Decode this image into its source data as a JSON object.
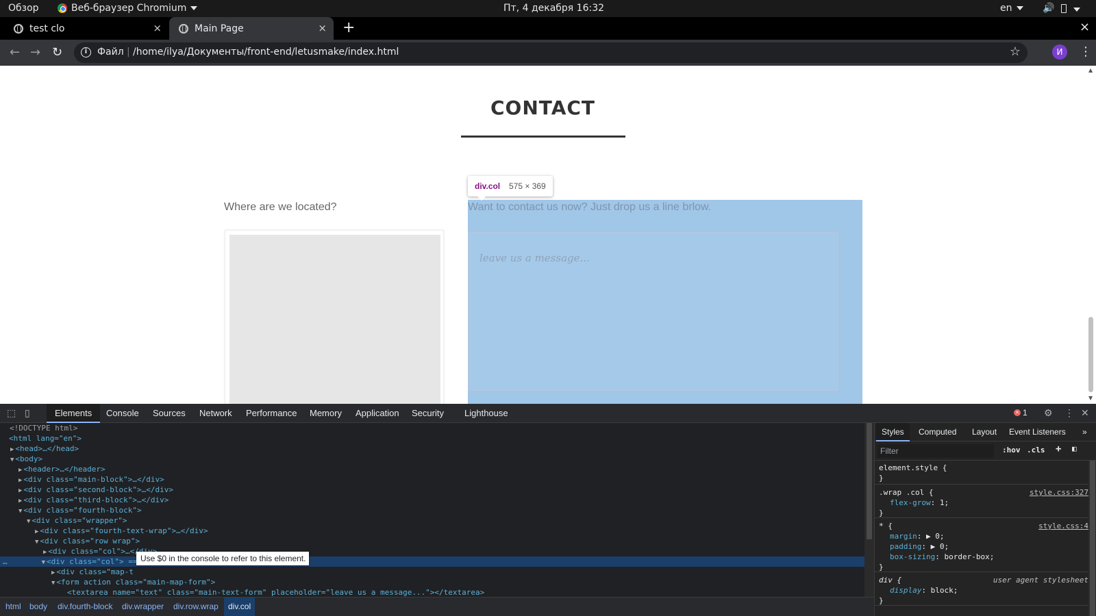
{
  "gnome": {
    "overview": "Обзор",
    "app_name": "Веб-браузер Chromium",
    "clock": "Пт, 4 декабря  16:32",
    "lang": "en"
  },
  "browser": {
    "tabs": [
      {
        "title": "test clo"
      },
      {
        "title": "Main Page"
      }
    ],
    "newtab_label": "+",
    "close_glyph": "×",
    "scheme_label": "Файл",
    "url": "/home/ilya/Документы/front-end/letusmake/index.html",
    "avatar_initial": "И"
  },
  "page": {
    "contact_title": "CONTACT",
    "located_text": "Where are we located?",
    "contact_now_text": "Want to contact us now? Just drop us a line brlow.",
    "textarea_placeholder": "leave us a message...",
    "inspect_tooltip": {
      "tag": "div.col",
      "dims": "575 × 369"
    }
  },
  "devtools": {
    "tabs": [
      "Elements",
      "Console",
      "Sources",
      "Network",
      "Performance",
      "Memory",
      "Application",
      "Security",
      "Lighthouse"
    ],
    "error_count": "1",
    "dom_lines": [
      {
        "t": "<!DOCTYPE html>"
      },
      {
        "t": "<html lang=\"en\">"
      },
      {
        "t": "<head>…</head>"
      },
      {
        "t": "<body>"
      },
      {
        "t": "<header>…</header>"
      },
      {
        "t": "<div class=\"main-block\">…</div>"
      },
      {
        "t": "<div class=\"second-block\">…</div>"
      },
      {
        "t": "<div class=\"third-block\">…</div>"
      },
      {
        "t": "<div class=\"fourth-block\">"
      },
      {
        "t": "<div class=\"wrapper\">"
      },
      {
        "t": "<div class=\"fourth-text-wrap\">…</div>"
      },
      {
        "t": "<div class=\"row wrap\">"
      },
      {
        "t": "<div class=\"col\">…</div>"
      },
      {
        "t": "<div class=\"col\"> == $0"
      },
      {
        "t": "<div class=\"map-t"
      },
      {
        "t": "<form action class=\"main-map-form\">"
      },
      {
        "t": "<textarea name=\"text\" class=\"main-text-form\" placeholder=\"leave us a message...\"></textarea>"
      }
    ],
    "selected_marker": "…",
    "console_tip": "Use $0 in the console to refer to this element.",
    "breadcrumbs": [
      "html",
      "body",
      "div.fourth-block",
      "div.wrapper",
      "div.row.wrap",
      "div.col"
    ],
    "styles": {
      "tabs": [
        "Styles",
        "Computed",
        "Layout",
        "Event Listeners"
      ],
      "more_glyph": "»",
      "filter_placeholder": "Filter",
      "hov": ":hov",
      "cls": ".cls",
      "rules": [
        {
          "selector": "element.style {",
          "source": "",
          "props": [],
          "close": "}"
        },
        {
          "selector": ".wrap .col {",
          "source": "style.css:327",
          "props": [
            {
              "n": "flex-grow",
              "v": "1;"
            }
          ],
          "close": "}"
        },
        {
          "selector": "* {",
          "source": "style.css:4",
          "props": [
            {
              "n": "margin",
              "v": "▶ 0;"
            },
            {
              "n": "padding",
              "v": "▶ 0;"
            },
            {
              "n": "box-sizing",
              "v": "border-box;"
            }
          ],
          "close": "}"
        },
        {
          "selector": "div {",
          "source": "user agent stylesheet",
          "props": [
            {
              "n": "display",
              "v": "block;"
            }
          ],
          "close": "}"
        }
      ]
    }
  }
}
